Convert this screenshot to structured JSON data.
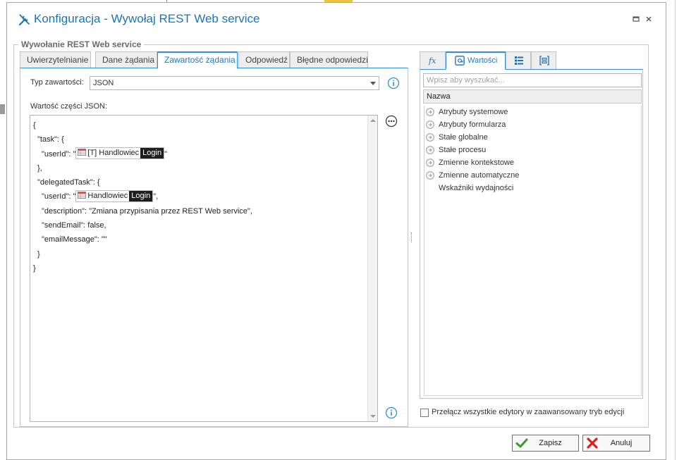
{
  "window": {
    "title": "Konfiguracja - Wywołaj REST Web service"
  },
  "group": {
    "legend": "Wywołanie REST Web service"
  },
  "tabs": [
    {
      "label": "Uwierzytelnianie"
    },
    {
      "label": "Dane żądania"
    },
    {
      "label": "Zawartość żądania"
    },
    {
      "label": "Odpowiedź"
    },
    {
      "label": "Błędne odpowiedzi"
    }
  ],
  "active_tab": "Zawartość żądania",
  "content_type": {
    "label": "Typ zawartości:",
    "value": "JSON"
  },
  "json_section": {
    "label": "Wartość części JSON:"
  },
  "json_editor": {
    "l1": "{",
    "l2": "\"task\": {",
    "l3_pre": "\"userId\": \"",
    "l3_token_text": "[T] Handlowiec",
    "l3_token_sub": "Login",
    "l3_post": "\"",
    "l4": "},",
    "l5": "\"delegatedTask\": {",
    "l6_pre": "\"userId\": \"",
    "l6_token_text": "Handlowiec",
    "l6_token_sub": "Login",
    "l6_post": "\",",
    "l7": "\"description\": \"Zmiana przypisania przez REST Web service\",",
    "l8": "\"sendEmail\": false,",
    "l9": "\"emailMessage\": \"\"",
    "l10": "}",
    "l11": "}"
  },
  "right_panel": {
    "tabs": [
      {
        "icon": "fx-icon"
      },
      {
        "icon": "values-icon",
        "label": "Wartości"
      },
      {
        "icon": "list-icon"
      },
      {
        "icon": "form-icon"
      }
    ],
    "search_placeholder": "Wpisz aby wyszukać...",
    "tree_header": "Nazwa",
    "items": [
      {
        "label": "Atrybuty systemowe",
        "expandable": true
      },
      {
        "label": "Atrybuty formularza",
        "expandable": true
      },
      {
        "label": "Stałe globalne",
        "expandable": true
      },
      {
        "label": "Stałe procesu",
        "expandable": true
      },
      {
        "label": "Zmienne kontekstowe",
        "expandable": true
      },
      {
        "label": "Zmienne automatyczne",
        "expandable": true
      },
      {
        "label": "Wskaźniki wydajności",
        "expandable": false
      }
    ]
  },
  "advanced_mode": {
    "label": "Przełącz wszystkie edytory w zaawansowany tryb edycji",
    "checked": false
  },
  "buttons": {
    "save": "Zapisz",
    "cancel": "Anuluj"
  },
  "colors": {
    "accent": "#2e8fd6",
    "title": "#1b73ba",
    "save_icon": "#3a9b2f",
    "cancel_icon": "#d92020"
  }
}
